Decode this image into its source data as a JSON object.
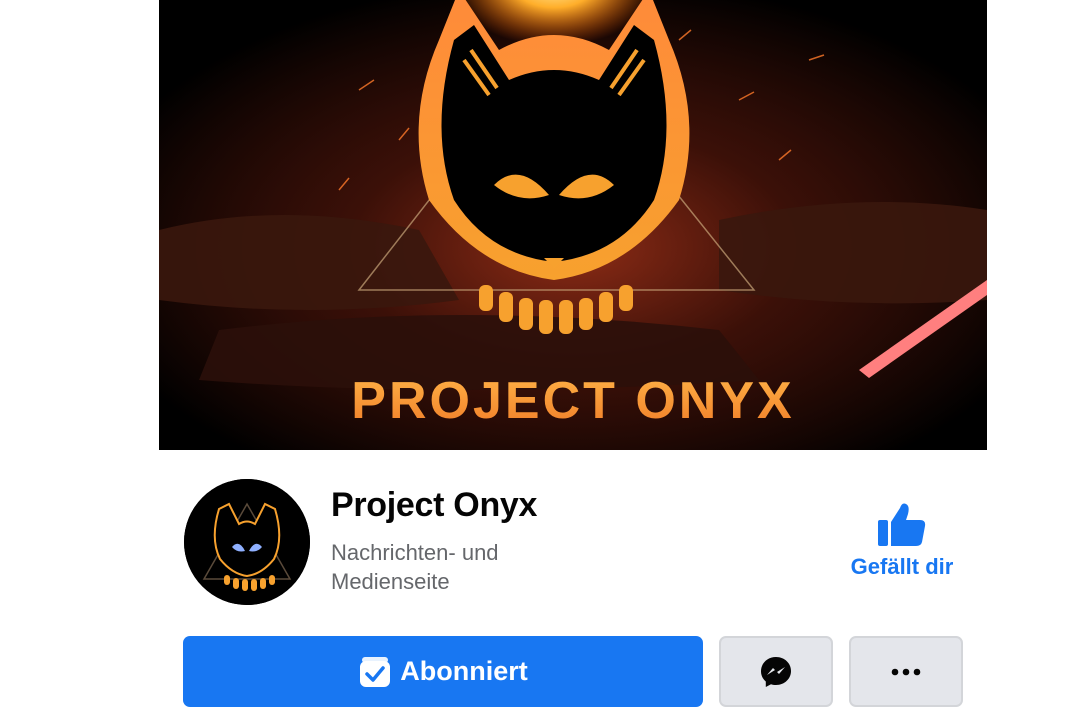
{
  "cover": {
    "banner_text": "PROJECT ONYX",
    "alt": "cover-photo"
  },
  "profile": {
    "name": "Project Onyx",
    "category": "Nachrichten- und Medienseite"
  },
  "like": {
    "label": "Gefällt dir",
    "icon": "thumbs-up-icon",
    "state": "liked"
  },
  "actions": {
    "subscribe_label": "Abonniert",
    "subscribe_icon": "subscribed-check-icon",
    "messenger_icon": "messenger-icon",
    "more_icon": "more-dots-icon"
  },
  "colors": {
    "brand_blue": "#1877f2",
    "secondary_bg": "#e4e6eb",
    "text_primary": "#050505",
    "text_secondary": "#65676b",
    "logo_orange": "#f7a12e"
  }
}
